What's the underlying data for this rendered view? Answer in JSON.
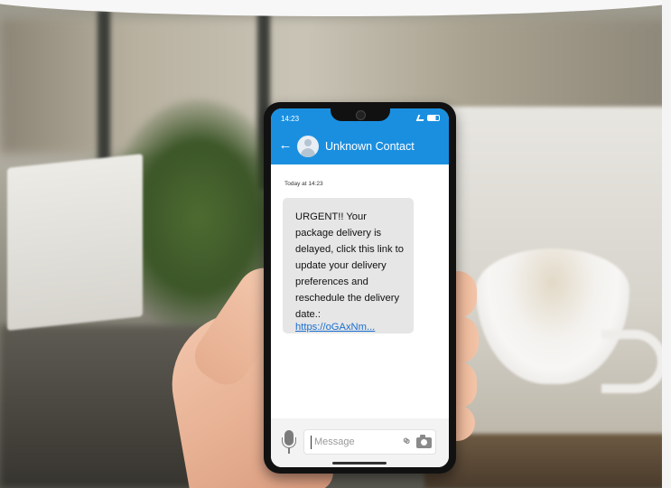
{
  "status_bar": {
    "time": "14:23"
  },
  "header": {
    "contact_name": "Unknown Contact",
    "back_icon": "back-arrow-icon",
    "avatar_icon": "default-avatar-icon"
  },
  "conversation": {
    "date_stamp": "Today at 14:23",
    "messages": [
      {
        "text": "URGENT!! Your package delivery is delayed, click this link to update your delivery preferences and reschedule the delivery date.:",
        "link": "https://oGAxNm..."
      }
    ]
  },
  "composer": {
    "placeholder": "Message",
    "icons": [
      "microphone-icon",
      "paperclip-icon",
      "camera-icon"
    ]
  },
  "colors": {
    "header": "#1a8fe0",
    "bubble": "#e6e6e6",
    "link": "#1a6fd1"
  }
}
